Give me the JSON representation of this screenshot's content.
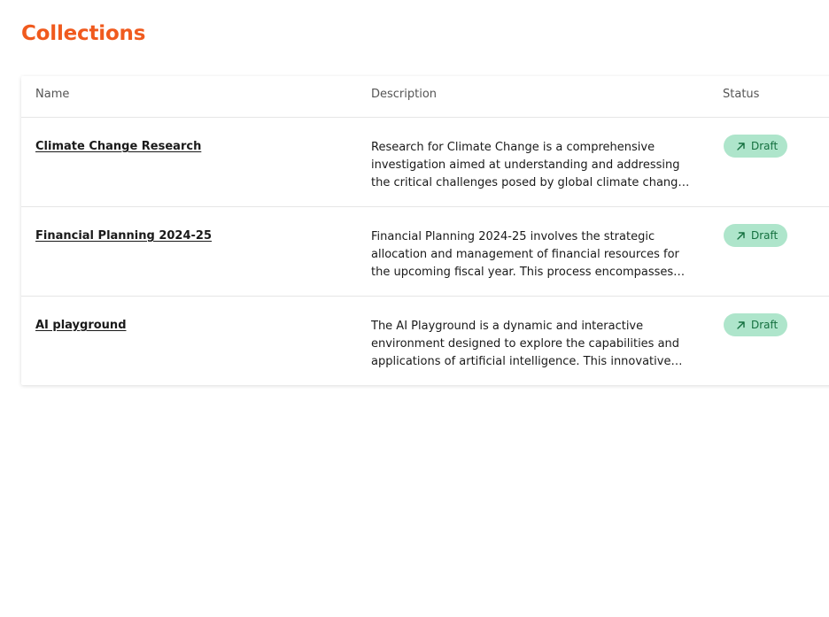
{
  "page": {
    "title": "Collections"
  },
  "colors": {
    "accent": "#f05a1e",
    "badge_bg": "#aee5cb",
    "badge_text": "#14703f"
  },
  "table": {
    "columns": {
      "name": "Name",
      "description": "Description",
      "status": "Status"
    },
    "rows": [
      {
        "name": "Climate Change Research",
        "description": "Research for Climate Change is a comprehensive investigation aimed at understanding and addressing the critical challenges posed by global climate change. This…",
        "status": "Draft",
        "status_icon": "arrow-up-right-icon"
      },
      {
        "name": "Financial Planning 2024-25",
        "description": "Financial Planning 2024-25 involves the strategic allocation and management of financial resources for the upcoming fiscal year. This process encompasses…",
        "status": "Draft",
        "status_icon": "arrow-up-right-icon"
      },
      {
        "name": "AI playground",
        "description": "The AI Playground is a dynamic and interactive environment designed to explore the capabilities and applications of artificial intelligence. This innovative…",
        "status": "Draft",
        "status_icon": "arrow-up-right-icon"
      }
    ]
  }
}
